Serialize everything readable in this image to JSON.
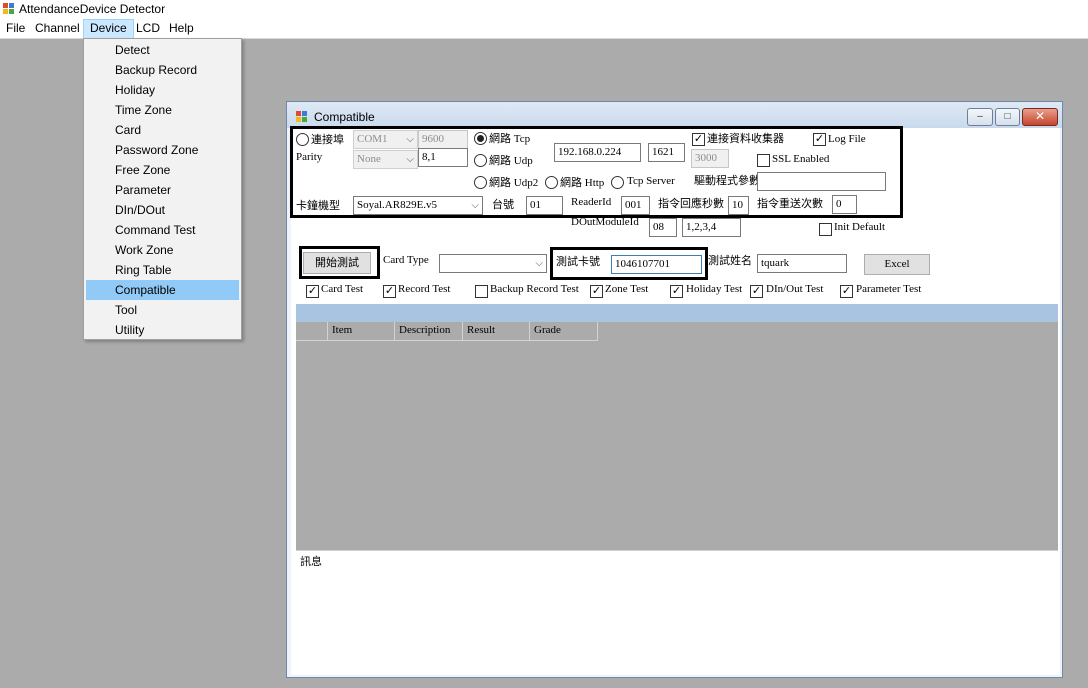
{
  "app": {
    "title": "AttendanceDevice Detector"
  },
  "menubar": {
    "items": [
      "File",
      "Channel",
      "Device",
      "LCD",
      "Help"
    ],
    "active": "Device"
  },
  "device_menu": {
    "items": [
      "Detect",
      "Backup Record",
      "Holiday",
      "Time Zone",
      "Card",
      "Password Zone",
      "Free Zone",
      "Parameter",
      "DIn/DOut",
      "Command Test",
      "Work Zone",
      "Ring Table",
      "Compatible",
      "Tool",
      "Utility"
    ],
    "highlighted": "Compatible"
  },
  "window": {
    "title": "Compatible",
    "min": "–",
    "max": "□",
    "close": "✕"
  },
  "connection": {
    "com_label": "連接埠",
    "com_port": "COM1",
    "baud": "9600",
    "parity_label": "Parity",
    "parity": "None",
    "data_bits": "8,1",
    "tcp_label": "網路 Tcp",
    "udp_label": "網路 Udp",
    "udp2_label": "網路 Udp2",
    "http_label": "網路 Http",
    "tcp_server_label": "Tcp Server",
    "ip": "192.168.0.224",
    "port": "1621",
    "port2": "3000",
    "collector_label": "連接資料收集器",
    "log_label": "Log File",
    "ssl_label": "SSL Enabled",
    "driver_param_label": "驅動程式參數",
    "driver_param": "",
    "model_label": "卡鐘機型",
    "model": "Soyal.AR829E.v5",
    "node_label": "台號",
    "node": "01",
    "reader_label": "ReaderId",
    "reader": "001",
    "timeout_label": "指令回應秒數",
    "timeout": "10",
    "retry_label": "指令重送次數",
    "retry": "0",
    "dout_label": "DOutModuleId",
    "dout_id": "08",
    "dout_list": "1,2,3,4",
    "init_default_label": "Init Default"
  },
  "test": {
    "start_label": "開始測試",
    "card_type_label": "Card Type",
    "card_type": "",
    "card_no_label": "測試卡號",
    "card_no": "1046107701",
    "name_label": "測試姓名",
    "name": "tquark",
    "excel_label": "Excel",
    "options": [
      {
        "label": "Card Test",
        "checked": true
      },
      {
        "label": "Record Test",
        "checked": true
      },
      {
        "label": "Backup Record Test",
        "checked": false
      },
      {
        "label": "Zone Test",
        "checked": true
      },
      {
        "label": "Holiday Test",
        "checked": true
      },
      {
        "label": "DIn/Out Test",
        "checked": true
      },
      {
        "label": "Parameter Test",
        "checked": true
      }
    ]
  },
  "grid": {
    "columns": [
      "",
      "Item",
      "Description",
      "Result",
      "Grade"
    ]
  },
  "message": {
    "label": "訊息"
  },
  "colors": {
    "menu_highlight": "#91c9f7",
    "desktop": "#ababab",
    "grid_header_bar": "#a9c4e0"
  }
}
